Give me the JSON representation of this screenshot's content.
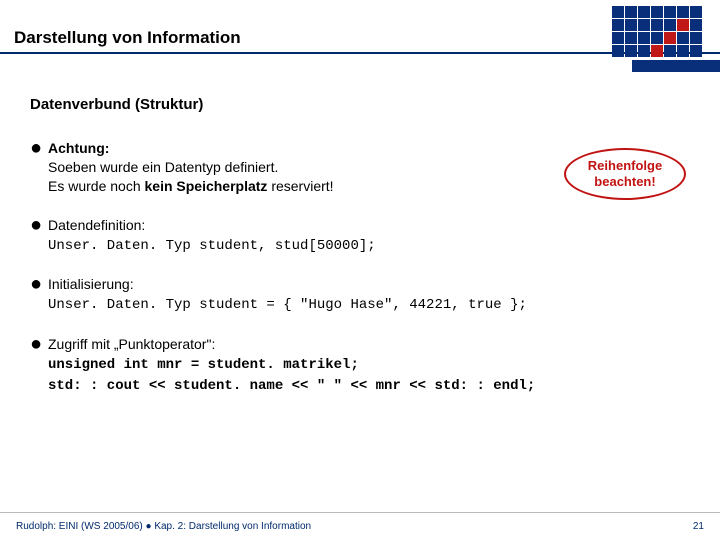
{
  "header": {
    "title": "Darstellung von Information"
  },
  "subtitle": "Datenverbund (Struktur)",
  "bullets": {
    "b1_head": "Achtung:",
    "b1_l1": "Soeben wurde ein Datentyp definiert.",
    "b1_l2a": "Es wurde noch ",
    "b1_l2b": "kein Speicherplatz",
    "b1_l2c": " reserviert!",
    "b2_head": "Datendefinition:",
    "b2_code": "Unser. Daten. Typ student, stud[50000];",
    "b3_head": "Initialisierung:",
    "b3_code": "Unser. Daten. Typ student = { \"Hugo Hase\", 44221, true };",
    "b4_head": "Zugriff mit „Punktoperator\":",
    "b4_code1": "unsigned int mnr = student. matrikel;",
    "b4_code2": "std: : cout << student. name << \" \" << mnr << std: : endl;"
  },
  "callout": {
    "l1": "Reihenfolge",
    "l2": "beachten!"
  },
  "footer": {
    "left": "Rudolph: EINI (WS 2005/06)  ●  Kap. 2: Darstellung von Information",
    "page": "21"
  }
}
